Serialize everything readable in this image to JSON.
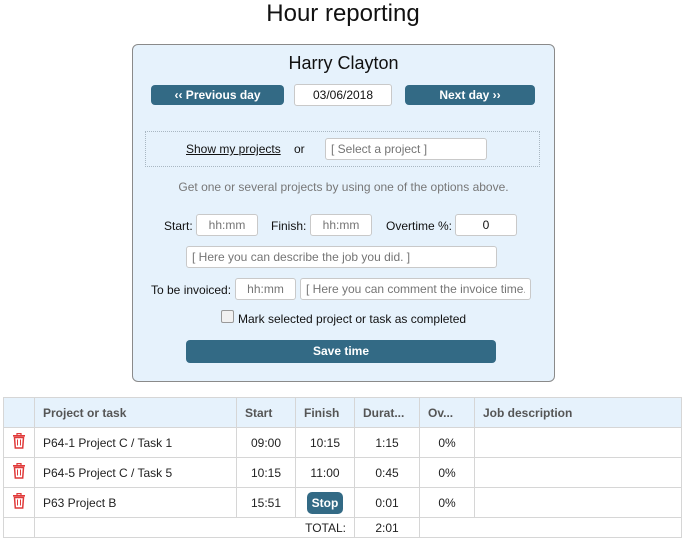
{
  "page": {
    "title": "Hour reporting"
  },
  "panel": {
    "user_name": "Harry Clayton",
    "prev_day_label": "‹‹ Previous day",
    "next_day_label": "Next day ››",
    "date_value": "03/06/2018",
    "show_projects_link": "Show my projects",
    "or_text": "or",
    "select_project_placeholder": "[ Select a project ]",
    "hint": "Get one or several projects by using one of the options above.",
    "start_label": "Start:",
    "start_placeholder": "hh:mm",
    "finish_label": "Finish:",
    "finish_placeholder": "hh:mm",
    "overtime_label": "Overtime %:",
    "overtime_value": "0",
    "job_description_placeholder": "[ Here you can describe the job you did. ]",
    "invoiced_label": "To be invoiced:",
    "invoiced_placeholder": "hh:mm",
    "invoice_comment_placeholder": "[ Here you can comment the invoice time. ]",
    "completed_label": "Mark selected project or task as completed",
    "completed_checked": false,
    "save_label": "Save time"
  },
  "table": {
    "headers": [
      "",
      "Project or task",
      "Start",
      "Finish",
      "Durat...",
      "Ov...",
      "Job description"
    ],
    "rows": [
      {
        "project": "P64-1 Project C / Task 1",
        "start": "09:00",
        "finish": "10:15",
        "duration": "1:15",
        "overtime": "0%",
        "description": ""
      },
      {
        "project": "P64-5 Project C / Task 5",
        "start": "10:15",
        "finish": "11:00",
        "duration": "0:45",
        "overtime": "0%",
        "description": ""
      },
      {
        "project": "P63 Project B",
        "start": "15:51",
        "finish": "",
        "duration": "0:01",
        "overtime": "0%",
        "description": "",
        "stop_label": "Stop"
      }
    ],
    "total_label": "TOTAL:",
    "total_value": "2:01"
  },
  "colors": {
    "accent": "#336a85",
    "panel_bg": "#e6f2fc",
    "delete": "#e03a3a"
  }
}
